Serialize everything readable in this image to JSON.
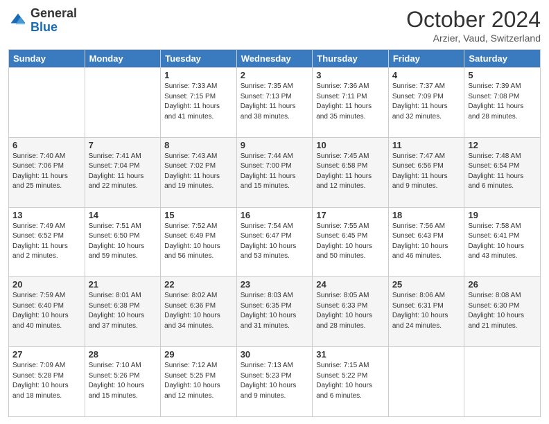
{
  "header": {
    "logo": {
      "line1": "General",
      "line2": "Blue"
    },
    "title": "October 2024",
    "subtitle": "Arzier, Vaud, Switzerland"
  },
  "days_of_week": [
    "Sunday",
    "Monday",
    "Tuesday",
    "Wednesday",
    "Thursday",
    "Friday",
    "Saturday"
  ],
  "weeks": [
    [
      {
        "day": "",
        "sunrise": "",
        "sunset": "",
        "daylight": ""
      },
      {
        "day": "",
        "sunrise": "",
        "sunset": "",
        "daylight": ""
      },
      {
        "day": "1",
        "sunrise": "Sunrise: 7:33 AM",
        "sunset": "Sunset: 7:15 PM",
        "daylight": "Daylight: 11 hours and 41 minutes."
      },
      {
        "day": "2",
        "sunrise": "Sunrise: 7:35 AM",
        "sunset": "Sunset: 7:13 PM",
        "daylight": "Daylight: 11 hours and 38 minutes."
      },
      {
        "day": "3",
        "sunrise": "Sunrise: 7:36 AM",
        "sunset": "Sunset: 7:11 PM",
        "daylight": "Daylight: 11 hours and 35 minutes."
      },
      {
        "day": "4",
        "sunrise": "Sunrise: 7:37 AM",
        "sunset": "Sunset: 7:09 PM",
        "daylight": "Daylight: 11 hours and 32 minutes."
      },
      {
        "day": "5",
        "sunrise": "Sunrise: 7:39 AM",
        "sunset": "Sunset: 7:08 PM",
        "daylight": "Daylight: 11 hours and 28 minutes."
      }
    ],
    [
      {
        "day": "6",
        "sunrise": "Sunrise: 7:40 AM",
        "sunset": "Sunset: 7:06 PM",
        "daylight": "Daylight: 11 hours and 25 minutes."
      },
      {
        "day": "7",
        "sunrise": "Sunrise: 7:41 AM",
        "sunset": "Sunset: 7:04 PM",
        "daylight": "Daylight: 11 hours and 22 minutes."
      },
      {
        "day": "8",
        "sunrise": "Sunrise: 7:43 AM",
        "sunset": "Sunset: 7:02 PM",
        "daylight": "Daylight: 11 hours and 19 minutes."
      },
      {
        "day": "9",
        "sunrise": "Sunrise: 7:44 AM",
        "sunset": "Sunset: 7:00 PM",
        "daylight": "Daylight: 11 hours and 15 minutes."
      },
      {
        "day": "10",
        "sunrise": "Sunrise: 7:45 AM",
        "sunset": "Sunset: 6:58 PM",
        "daylight": "Daylight: 11 hours and 12 minutes."
      },
      {
        "day": "11",
        "sunrise": "Sunrise: 7:47 AM",
        "sunset": "Sunset: 6:56 PM",
        "daylight": "Daylight: 11 hours and 9 minutes."
      },
      {
        "day": "12",
        "sunrise": "Sunrise: 7:48 AM",
        "sunset": "Sunset: 6:54 PM",
        "daylight": "Daylight: 11 hours and 6 minutes."
      }
    ],
    [
      {
        "day": "13",
        "sunrise": "Sunrise: 7:49 AM",
        "sunset": "Sunset: 6:52 PM",
        "daylight": "Daylight: 11 hours and 2 minutes."
      },
      {
        "day": "14",
        "sunrise": "Sunrise: 7:51 AM",
        "sunset": "Sunset: 6:50 PM",
        "daylight": "Daylight: 10 hours and 59 minutes."
      },
      {
        "day": "15",
        "sunrise": "Sunrise: 7:52 AM",
        "sunset": "Sunset: 6:49 PM",
        "daylight": "Daylight: 10 hours and 56 minutes."
      },
      {
        "day": "16",
        "sunrise": "Sunrise: 7:54 AM",
        "sunset": "Sunset: 6:47 PM",
        "daylight": "Daylight: 10 hours and 53 minutes."
      },
      {
        "day": "17",
        "sunrise": "Sunrise: 7:55 AM",
        "sunset": "Sunset: 6:45 PM",
        "daylight": "Daylight: 10 hours and 50 minutes."
      },
      {
        "day": "18",
        "sunrise": "Sunrise: 7:56 AM",
        "sunset": "Sunset: 6:43 PM",
        "daylight": "Daylight: 10 hours and 46 minutes."
      },
      {
        "day": "19",
        "sunrise": "Sunrise: 7:58 AM",
        "sunset": "Sunset: 6:41 PM",
        "daylight": "Daylight: 10 hours and 43 minutes."
      }
    ],
    [
      {
        "day": "20",
        "sunrise": "Sunrise: 7:59 AM",
        "sunset": "Sunset: 6:40 PM",
        "daylight": "Daylight: 10 hours and 40 minutes."
      },
      {
        "day": "21",
        "sunrise": "Sunrise: 8:01 AM",
        "sunset": "Sunset: 6:38 PM",
        "daylight": "Daylight: 10 hours and 37 minutes."
      },
      {
        "day": "22",
        "sunrise": "Sunrise: 8:02 AM",
        "sunset": "Sunset: 6:36 PM",
        "daylight": "Daylight: 10 hours and 34 minutes."
      },
      {
        "day": "23",
        "sunrise": "Sunrise: 8:03 AM",
        "sunset": "Sunset: 6:35 PM",
        "daylight": "Daylight: 10 hours and 31 minutes."
      },
      {
        "day": "24",
        "sunrise": "Sunrise: 8:05 AM",
        "sunset": "Sunset: 6:33 PM",
        "daylight": "Daylight: 10 hours and 28 minutes."
      },
      {
        "day": "25",
        "sunrise": "Sunrise: 8:06 AM",
        "sunset": "Sunset: 6:31 PM",
        "daylight": "Daylight: 10 hours and 24 minutes."
      },
      {
        "day": "26",
        "sunrise": "Sunrise: 8:08 AM",
        "sunset": "Sunset: 6:30 PM",
        "daylight": "Daylight: 10 hours and 21 minutes."
      }
    ],
    [
      {
        "day": "27",
        "sunrise": "Sunrise: 7:09 AM",
        "sunset": "Sunset: 5:28 PM",
        "daylight": "Daylight: 10 hours and 18 minutes."
      },
      {
        "day": "28",
        "sunrise": "Sunrise: 7:10 AM",
        "sunset": "Sunset: 5:26 PM",
        "daylight": "Daylight: 10 hours and 15 minutes."
      },
      {
        "day": "29",
        "sunrise": "Sunrise: 7:12 AM",
        "sunset": "Sunset: 5:25 PM",
        "daylight": "Daylight: 10 hours and 12 minutes."
      },
      {
        "day": "30",
        "sunrise": "Sunrise: 7:13 AM",
        "sunset": "Sunset: 5:23 PM",
        "daylight": "Daylight: 10 hours and 9 minutes."
      },
      {
        "day": "31",
        "sunrise": "Sunrise: 7:15 AM",
        "sunset": "Sunset: 5:22 PM",
        "daylight": "Daylight: 10 hours and 6 minutes."
      },
      {
        "day": "",
        "sunrise": "",
        "sunset": "",
        "daylight": ""
      },
      {
        "day": "",
        "sunrise": "",
        "sunset": "",
        "daylight": ""
      }
    ]
  ]
}
